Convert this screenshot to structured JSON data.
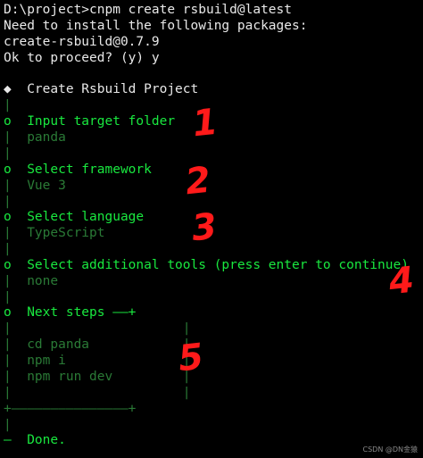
{
  "terminal": {
    "command_line": "D:\\project>cnpm create rsbuild@latest",
    "install_notice": "Need to install the following packages:",
    "package": "create-rsbuild@0.7.9",
    "proceed_prompt": "Ok to proceed? (y) y",
    "project_title": "◆  Create Rsbuild Project",
    "bar_line": "|",
    "steps": [
      {
        "label": "o  Input target folder",
        "answer": "|  panda"
      },
      {
        "label": "o  Select framework",
        "answer": "|  Vue 3"
      },
      {
        "label": "o  Select language",
        "answer": "|  TypeScript"
      },
      {
        "label": "o  Select additional tools (press enter to continue)",
        "answer": "|  none"
      }
    ],
    "next_steps_header": "o  Next steps —–+",
    "next_steps_box": [
      "|                      |",
      "|  cd panda            |",
      "|  npm i               |",
      "|  npm run dev         |",
      "|                      |",
      "+–––––––––––––––+"
    ],
    "done": "—  Done."
  },
  "annotations": [
    "1",
    "2",
    "3",
    "4",
    "5"
  ],
  "watermark": "CSDN @DN金猿",
  "colors": {
    "background": "#000000",
    "text_white": "#e8e8e8",
    "text_green": "#19e83f",
    "text_dim_green": "#2a7a36",
    "annotation_red": "#ff1a1a"
  }
}
